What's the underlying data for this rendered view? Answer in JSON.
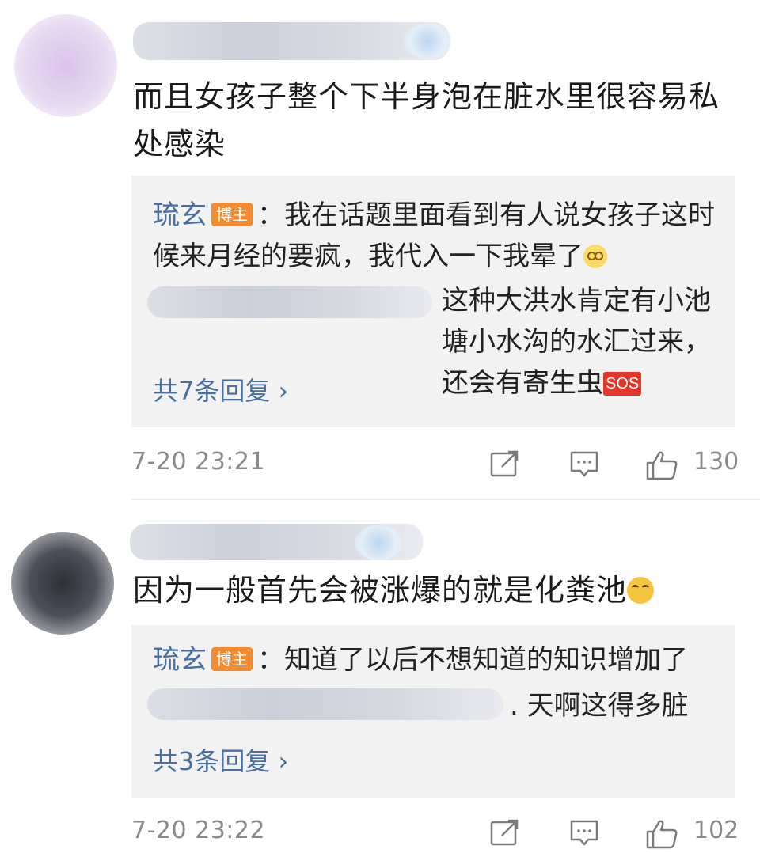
{
  "comments": [
    {
      "text": "而且女孩子整个下半身泡在脏水里很容易私处感染",
      "reply": {
        "author": "琉玄",
        "badge": "博主",
        "first_text": "：我在话题里面看到有人说女孩子这时候来月经的要疯，我代入一下我晕了",
        "second_text": "这种大洪水肯定有小池塘小水沟的水汇过来，还会有寄生虫",
        "sos": "SOS",
        "more": "共7条回复 ›"
      },
      "time": "7-20 23:21",
      "likes": "130"
    },
    {
      "text": "因为一般首先会被涨爆的就是化粪池",
      "reply": {
        "author": "琉玄",
        "badge": "博主",
        "first_text": "：知道了以后不想知道的知识增加了",
        "second_text": ". 天啊这得多脏",
        "more": "共3条回复 ›"
      },
      "time": "7-20 23:22",
      "likes": "102"
    }
  ]
}
